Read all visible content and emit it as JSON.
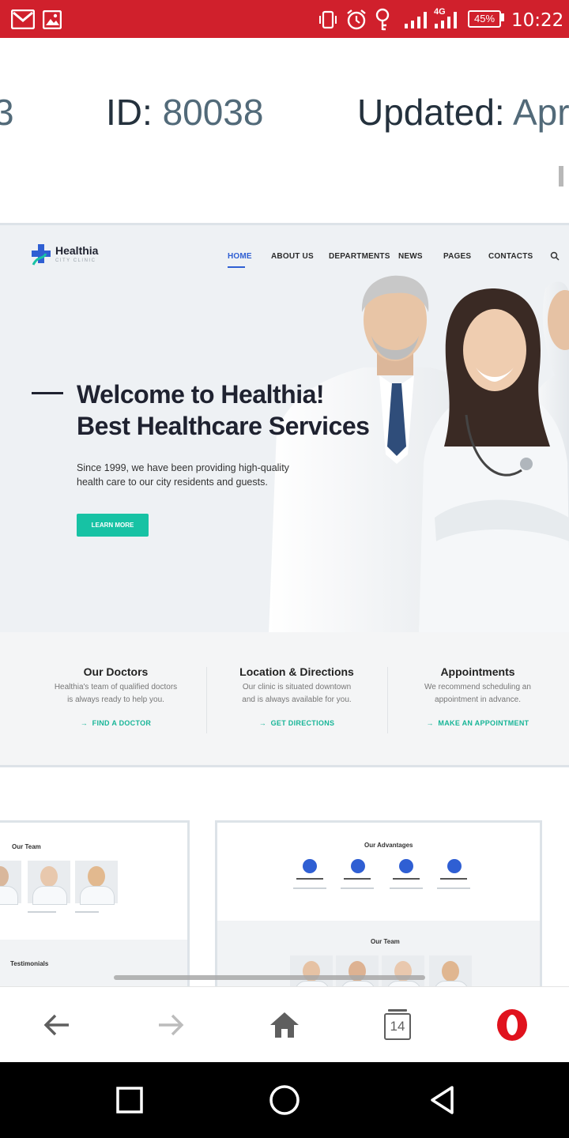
{
  "status_bar": {
    "icons": [
      "gmail-icon",
      "gallery-icon",
      "vibrate-icon",
      "alarm-icon",
      "key-icon",
      "signal-icon",
      "4g-signal-icon"
    ],
    "network_label": "4G",
    "battery": "45%",
    "time": "10:22"
  },
  "meta": {
    "partial_prev": "3",
    "id_label": "ID:",
    "id_value": "80038",
    "updated_label": "Updated:",
    "updated_value": "Apr"
  },
  "preview": {
    "logo_name": "Healthia",
    "logo_sub": "CITY CLINIC",
    "nav": [
      "HOME",
      "ABOUT US",
      "DEPARTMENTS",
      "NEWS",
      "PAGES",
      "CONTACTS"
    ],
    "active_nav": "HOME",
    "hero_title_line1": "Welcome to Healthia!",
    "hero_title_line2": "Best Healthcare Services",
    "hero_text": "Since 1999, we have been providing high-quality health care to our city residents and guests.",
    "hero_button": "LEARN MORE",
    "features": [
      {
        "title": "Our Doctors",
        "desc1": "Healthia's team of qualified doctors",
        "desc2": "is always ready to help you.",
        "link": "FIND A DOCTOR"
      },
      {
        "title": "Location & Directions",
        "desc1": "Our clinic is situated downtown",
        "desc2": "and is always available for you.",
        "link": "GET DIRECTIONS"
      },
      {
        "title": "Appointments",
        "desc1": "We recommend scheduling an",
        "desc2": "appointment in advance.",
        "link": "MAKE AN APPOINTMENT"
      }
    ],
    "accent": "#17c2a4"
  },
  "thumbs": {
    "left_title": "Our Team",
    "left_sub": "Testimonials",
    "right_title": "Our Advantages",
    "right_sub": "Our Team"
  },
  "browser": {
    "tab_count": "14",
    "icons": [
      "back-arrow-icon",
      "forward-arrow-icon",
      "home-icon",
      "tabs-icon",
      "opera-icon"
    ]
  },
  "nav_bar": {
    "icons": [
      "recents-square-icon",
      "home-circle-icon",
      "back-triangle-icon"
    ]
  }
}
